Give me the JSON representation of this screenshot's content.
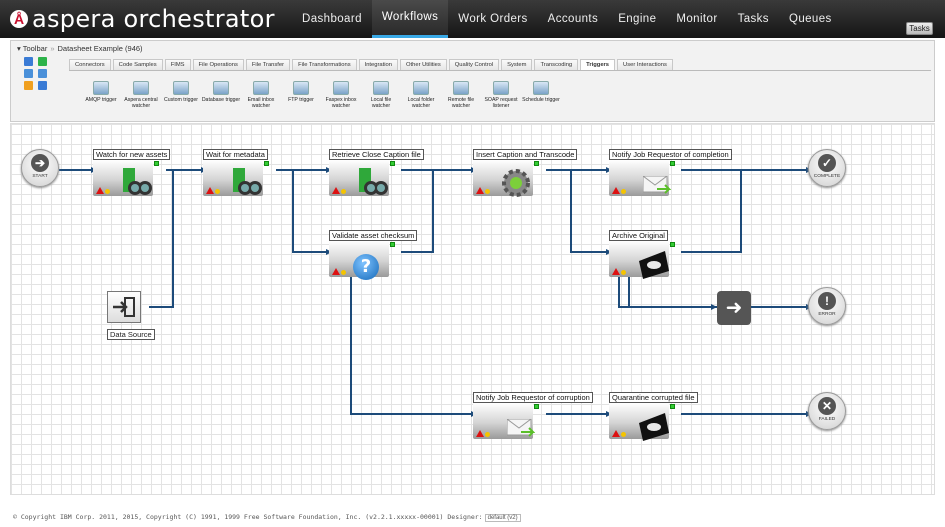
{
  "app": {
    "logo_text": "aspera orchestrator"
  },
  "nav": [
    "Dashboard",
    "Workflows",
    "Work Orders",
    "Accounts",
    "Engine",
    "Monitor",
    "Tasks",
    "Queues"
  ],
  "nav_active": "Workflows",
  "tasks_button": "Tasks",
  "toolbar": {
    "toggle": "▾ Toolbar",
    "breadcrumb": "Datasheet Example (946)",
    "tabs": [
      "Connectors",
      "Code Samples",
      "FIMS",
      "File Operations",
      "File Transfer",
      "File Transformations",
      "Integration",
      "Other Utilities",
      "Quality Control",
      "System",
      "Transcoding",
      "Triggers",
      "User Interactions"
    ],
    "active_tab": "Triggers",
    "palette": [
      {
        "label": "AMQP trigger"
      },
      {
        "label": "Aspera central watcher"
      },
      {
        "label": "Custom trigger"
      },
      {
        "label": "Database trigger"
      },
      {
        "label": "Email inbox watcher"
      },
      {
        "label": "FTP trigger"
      },
      {
        "label": "Faspex inbox watcher"
      },
      {
        "label": "Local file watcher"
      },
      {
        "label": "Local folder watcher"
      },
      {
        "label": "Remote file watcher"
      },
      {
        "label": "SOAP request listener"
      },
      {
        "label": "Schedule trigger"
      }
    ]
  },
  "workflow": {
    "nodes": [
      {
        "id": "watch",
        "label": "Watch for new assets",
        "icon": "binoculars-icon"
      },
      {
        "id": "wait",
        "label": "Wait for metadata",
        "icon": "binoculars-icon"
      },
      {
        "id": "retrieve",
        "label": "Retrieve Close Caption file",
        "icon": "binoculars-icon"
      },
      {
        "id": "insert",
        "label": "Insert Caption and Transcode",
        "icon": "gear-icon"
      },
      {
        "id": "notify_done",
        "label": "Notify Job Requestor of completion",
        "icon": "mail-icon"
      },
      {
        "id": "validate",
        "label": "Validate asset checksum",
        "icon": "help-icon"
      },
      {
        "id": "archive",
        "label": "Archive Original",
        "icon": "disk-icon"
      },
      {
        "id": "notify_corrupt",
        "label": "Notify Job Requestor of corruption",
        "icon": "mail-icon"
      },
      {
        "id": "quarantine",
        "label": "Quarantine corrupted file",
        "icon": "disk-icon"
      }
    ],
    "data_source": "Data Source",
    "terminals": {
      "start": "START",
      "complete": "COMPLETE",
      "error": "ERROR",
      "failed": "FAILED"
    }
  },
  "footer": {
    "copyright": "© Copyright IBM Corp. 2011, 2015, Copyright (C) 1991, 1999 Free Software Foundation, Inc. (v2.2.1.xxxxx-00001) Designer:",
    "designer": "default (v2)"
  },
  "colors": {
    "accent": "#39a9e6",
    "wire": "#1d4b7a",
    "error": "#d11111",
    "ok": "#f4c400"
  }
}
